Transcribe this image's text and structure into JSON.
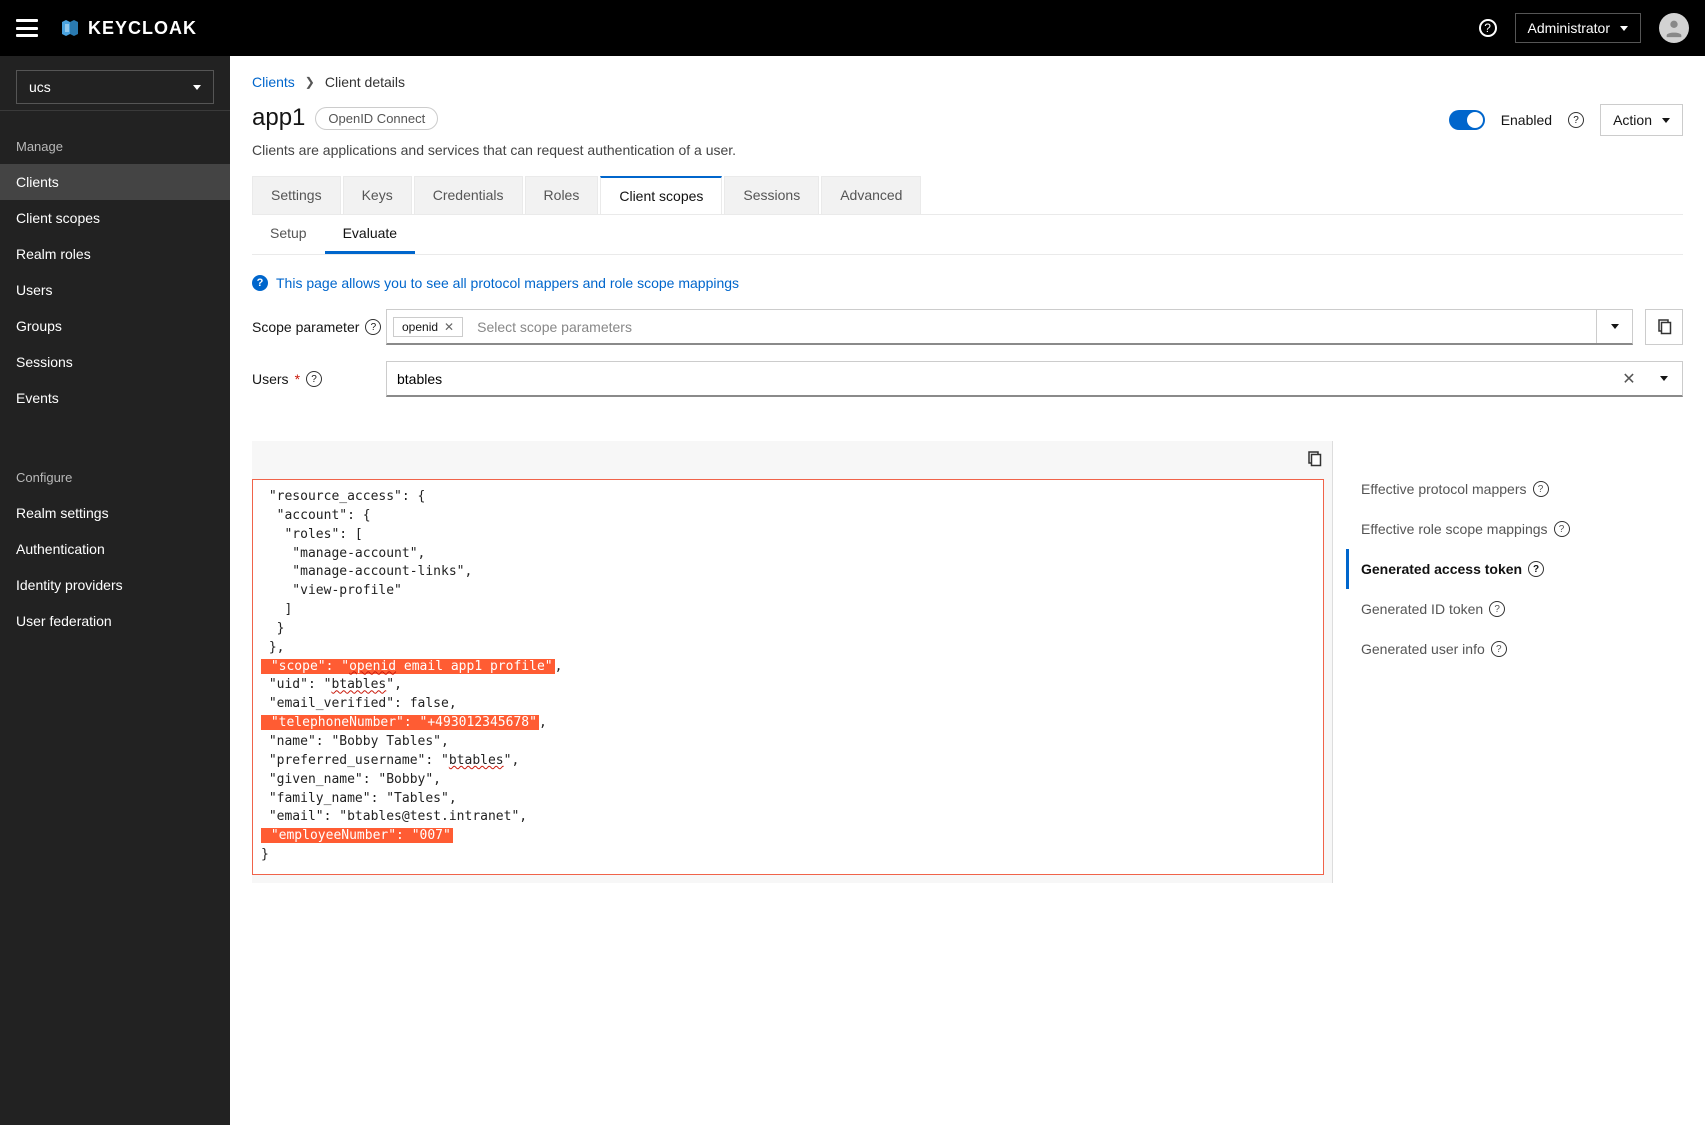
{
  "topbar": {
    "brand": "KEYCLOAK",
    "user_label": "Administrator"
  },
  "sidebar": {
    "realm": "ucs",
    "sections": {
      "manage": {
        "title": "Manage",
        "items": [
          "Clients",
          "Client scopes",
          "Realm roles",
          "Users",
          "Groups",
          "Sessions",
          "Events"
        ]
      },
      "configure": {
        "title": "Configure",
        "items": [
          "Realm settings",
          "Authentication",
          "Identity providers",
          "User federation"
        ]
      }
    },
    "active": "Clients"
  },
  "breadcrumb": {
    "root": "Clients",
    "current": "Client details"
  },
  "page": {
    "title": "app1",
    "protocol_chip": "OpenID Connect",
    "enabled_label": "Enabled",
    "action_label": "Action",
    "subtitle": "Clients are applications and services that can request authentication of a user."
  },
  "tabs": [
    "Settings",
    "Keys",
    "Credentials",
    "Roles",
    "Client scopes",
    "Sessions",
    "Advanced"
  ],
  "active_tab": "Client scopes",
  "subtabs": [
    "Setup",
    "Evaluate"
  ],
  "active_subtab": "Evaluate",
  "info_text": "This page allows you to see all protocol mappers and role scope mappings",
  "form": {
    "scope_label": "Scope parameter",
    "scope_chip": "openid",
    "scope_placeholder": "Select scope parameters",
    "users_label": "Users",
    "users_value": "btables"
  },
  "right_panel": {
    "items": [
      "Effective protocol mappers",
      "Effective role scope mappings",
      "Generated access token",
      "Generated ID token",
      "Generated user info"
    ],
    "active": "Generated access token"
  },
  "token": {
    "lines": [
      {
        "indent": "",
        "t": "\"resource_access\": {"
      },
      {
        "indent": " ",
        "t": "\"account\": {"
      },
      {
        "indent": "  ",
        "t": "\"roles\": ["
      },
      {
        "indent": "   ",
        "t": "\"manage-account\","
      },
      {
        "indent": "   ",
        "t": "\"manage-account-links\","
      },
      {
        "indent": "   ",
        "t": "\"view-profile\""
      },
      {
        "indent": "  ",
        "t": "]"
      },
      {
        "indent": " ",
        "t": "}"
      },
      {
        "indent": "",
        "t": "},"
      },
      {
        "indent": "",
        "hl": true,
        "pre": "\"scope\": \"",
        "wavy": "openid",
        "post": " email app1 profile\"",
        "tail": ","
      },
      {
        "indent": "",
        "pre": "\"uid\": \"",
        "wavy": "btables",
        "post": "\","
      },
      {
        "indent": "",
        "t": "\"email_verified\": false,"
      },
      {
        "indent": "",
        "hl": true,
        "t": "\"telephoneNumber\": \"+493012345678\"",
        "tail": ","
      },
      {
        "indent": "",
        "t": "\"name\": \"Bobby Tables\","
      },
      {
        "indent": "",
        "pre": "\"preferred_username\": \"",
        "wavy": "btables",
        "post": "\","
      },
      {
        "indent": "",
        "t": "\"given_name\": \"Bobby\","
      },
      {
        "indent": "",
        "t": "\"family_name\": \"Tables\","
      },
      {
        "indent": "",
        "t": "\"email\": \"btables@test.intranet\","
      },
      {
        "indent": "",
        "hl": true,
        "t": "\"employeeNumber\": \"007\""
      },
      {
        "indent": "",
        "outdent": true,
        "t": "}"
      }
    ]
  }
}
